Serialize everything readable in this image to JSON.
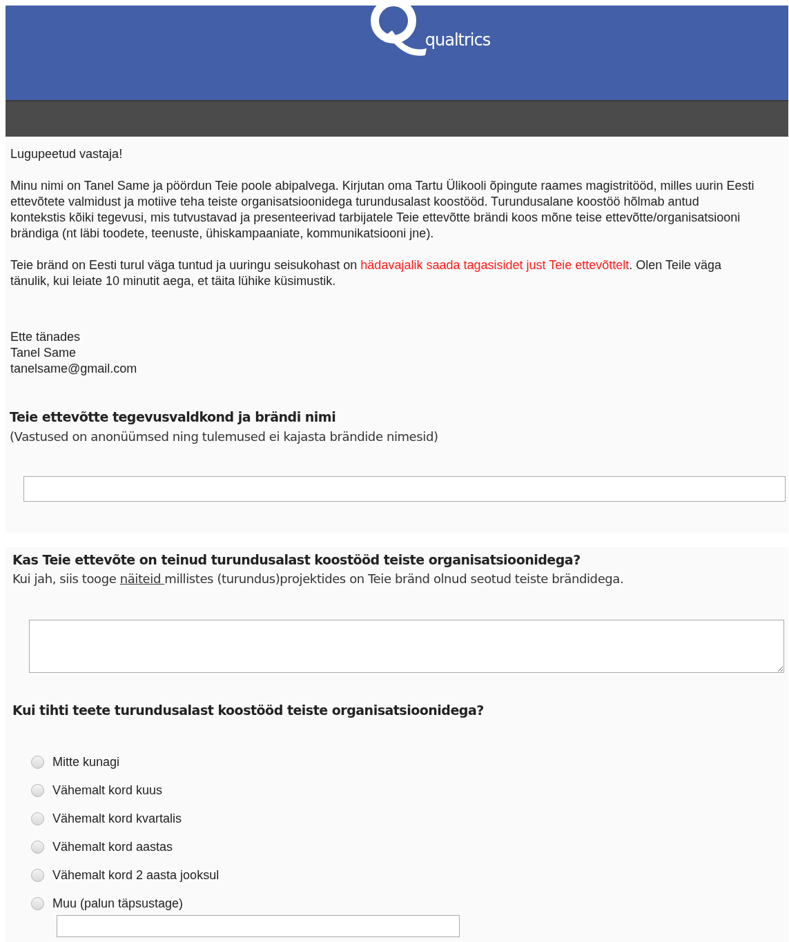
{
  "header": {
    "brand": "qualtrics"
  },
  "intro": {
    "greeting": "Lugupeetud vastaja!",
    "paragraphs": [
      [
        {
          "kind": "plain",
          "text": "Minu nimi on Tanel Same ja pöördun Teie poole abipalvega. Kirjutan oma Tartu Ülikooli õpingute raames magistritööd, milles uurin Eesti ettevõtete valmidust ja motiive teha teiste organisatsioonidega turundusalast koostööd. Turundusalane koostöö hõlmab antud kontekstis kõiki tegevusi, mis tutvustavad ja presenteerivad tarbijatele Teie ettevõtte brändi koos mõne teise ettevõtte/organisatsiooni brändiga (nt läbi toodete, teenuste, ühiskampaaniate, kommunikatsiooni jne)."
        }
      ],
      [
        {
          "kind": "plain",
          "text": "Teie bränd on Eesti turul väga tuntud ja uuringu seisukohast on "
        },
        {
          "kind": "highlight",
          "text": "hädavajalik saada tagasisidet just Teie ettevõttelt"
        },
        {
          "kind": "plain",
          "text": ". Olen Teile väga tänulik, kui leiate 10 minutit aega, et täita lühike küsimustik."
        }
      ]
    ],
    "signature": [
      "Ette tänades",
      "Tanel Same",
      "tanelsame@gmail.com"
    ]
  },
  "questions": [
    {
      "kind": "text",
      "title": "Teie ettevõtte tegevusvaldkond ja brändi nimi",
      "description": [
        {
          "kind": "plain",
          "text": "(Vastused on anonüümsed ning tulemused ei kajasta brändide nimesid)"
        }
      ]
    },
    {
      "kind": "textarea",
      "title": "Kas Teie ettevõte on teinud turundusalast koostööd teiste organisatsioonidega?",
      "description": [
        {
          "kind": "plain",
          "text": "Kui jah, siis tooge "
        },
        {
          "kind": "underline",
          "text": "näiteid "
        },
        {
          "kind": "plain",
          "text": "millistes (turundus)projektides on Teie bränd olnud seotud teiste brändidega."
        }
      ]
    },
    {
      "kind": "choice",
      "title": "Kui tihti teete turundusalast koostööd teiste organisatsioonidega?",
      "options": [
        {
          "label": "Mitte kunagi",
          "selected": false
        },
        {
          "label": "Vähemalt kord kuus",
          "selected": false
        },
        {
          "label": "Vähemalt kord kvartalis",
          "selected": false
        },
        {
          "label": "Vähemalt kord aastas",
          "selected": false
        },
        {
          "label": "Vähemalt kord 2 aasta jooksul",
          "selected": false
        },
        {
          "label": "Muu (palun täpsustage)",
          "selected": false,
          "other_field": true
        }
      ]
    }
  ]
}
